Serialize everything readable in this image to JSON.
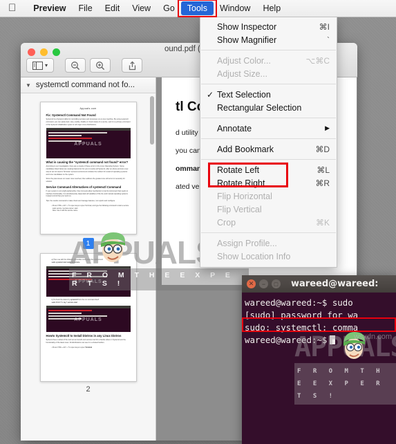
{
  "menubar": {
    "apple_icon": "apple-logo",
    "items": [
      {
        "label": "Preview",
        "bold": true,
        "active": false
      },
      {
        "label": "File",
        "bold": false,
        "active": false
      },
      {
        "label": "Edit",
        "bold": false,
        "active": false
      },
      {
        "label": "View",
        "bold": false,
        "active": false
      },
      {
        "label": "Go",
        "bold": false,
        "active": false
      },
      {
        "label": "Tools",
        "bold": false,
        "active": true
      },
      {
        "label": "Window",
        "bold": false,
        "active": false
      },
      {
        "label": "Help",
        "bold": false,
        "active": false
      }
    ],
    "highlight_color": "#2466d6",
    "annotation_color": "#e8000d"
  },
  "preview_window": {
    "title": "ound.pdf (pag",
    "traffic_lights": [
      "close-red",
      "minimize-yellow",
      "maximize-green"
    ],
    "toolbar": [
      {
        "name": "sidebar-view-button",
        "icon": "sidebar-icon"
      },
      {
        "name": "zoom-out-button",
        "icon": "magnifier-minus-icon"
      },
      {
        "name": "zoom-in-button",
        "icon": "magnifier-plus-icon"
      },
      {
        "name": "share-button",
        "icon": "share-icon"
      }
    ],
    "sidebar": {
      "header_label": "systemctl command not fo...",
      "disclosure_icon": "triangle-down-icon",
      "pages": [
        {
          "number": "1",
          "selected": true
        },
        {
          "number": "2",
          "selected": false
        }
      ],
      "thumb_site": "Appuals.com",
      "thumb_p1_heading": "Fix: Systemctl Command Not Found",
      "thumb_p1_heading2": "What is causing the \"systemctl command not found\" error?",
      "thumb_p1_heading3": "Service Command Alternatives of systemctl Command",
      "thumb_p2_heading": "Howto Systemctl to Install Distros in any Linux Distros"
    }
  },
  "pdf_content": {
    "heading_fragment": "tl Comm",
    "lines": [
      {
        "text": "d utility for c",
        "bold": false
      },
      {
        "text": "you can easil",
        "bold": false
      },
      {
        "text": "ommand not",
        "bold": true
      },
      {
        "text": "ated versions",
        "bold": false
      }
    ]
  },
  "tools_menu": {
    "groups": [
      {
        "items": [
          {
            "label": "Show Inspector",
            "shortcut": "⌘I",
            "disabled": false,
            "checked": false,
            "submenu": false
          },
          {
            "label": "Show Magnifier",
            "shortcut": "`",
            "disabled": false,
            "checked": false,
            "submenu": false
          }
        ]
      },
      {
        "items": [
          {
            "label": "Adjust Color...",
            "shortcut": "⌥⌘C",
            "disabled": true,
            "checked": false,
            "submenu": false
          },
          {
            "label": "Adjust Size...",
            "shortcut": "",
            "disabled": true,
            "checked": false,
            "submenu": false
          }
        ]
      },
      {
        "items": [
          {
            "label": "Text Selection",
            "shortcut": "",
            "disabled": false,
            "checked": true,
            "submenu": false
          },
          {
            "label": "Rectangular Selection",
            "shortcut": "",
            "disabled": false,
            "checked": false,
            "submenu": false
          }
        ]
      },
      {
        "items": [
          {
            "label": "Annotate",
            "shortcut": "",
            "disabled": false,
            "checked": false,
            "submenu": true
          }
        ]
      },
      {
        "items": [
          {
            "label": "Add Bookmark",
            "shortcut": "⌘D",
            "disabled": false,
            "checked": false,
            "submenu": false
          }
        ]
      },
      {
        "items": [
          {
            "label": "Rotate Left",
            "shortcut": "⌘L",
            "disabled": false,
            "checked": false,
            "submenu": false
          },
          {
            "label": "Rotate Right",
            "shortcut": "⌘R",
            "disabled": false,
            "checked": false,
            "submenu": false
          },
          {
            "label": "Flip Horizontal",
            "shortcut": "",
            "disabled": true,
            "checked": false,
            "submenu": false
          },
          {
            "label": "Flip Vertical",
            "shortcut": "",
            "disabled": true,
            "checked": false,
            "submenu": false
          },
          {
            "label": "Crop",
            "shortcut": "⌘K",
            "disabled": true,
            "checked": false,
            "submenu": false
          }
        ]
      },
      {
        "items": [
          {
            "label": "Assign Profile...",
            "shortcut": "",
            "disabled": true,
            "checked": false,
            "submenu": false
          },
          {
            "label": "Show Location Info",
            "shortcut": "",
            "disabled": true,
            "checked": false,
            "submenu": false
          }
        ]
      }
    ]
  },
  "terminal": {
    "title": "wareed@wareed:",
    "buttons": [
      "close",
      "minimize",
      "maximize"
    ],
    "lines": [
      {
        "text": "wareed@wareed:~$ sudo",
        "highlight": false
      },
      {
        "text": "[sudo] password for wa",
        "highlight": false
      },
      {
        "text": "sudo: systemctl: comma",
        "highlight": true
      },
      {
        "text": "wareed@wareed:~$",
        "highlight": false,
        "cursor": true
      }
    ],
    "background_color": "#340e2b",
    "annotation_color": "#e8000d"
  },
  "watermarks": {
    "brand": "APPUALS",
    "tagline": "F R O M   T H E   E X P E R T S !",
    "site": "wsxdn.com"
  }
}
